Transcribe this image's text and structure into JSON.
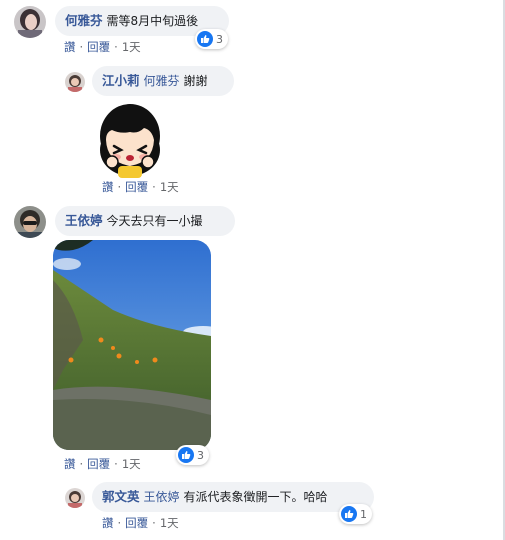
{
  "comments": [
    {
      "author": "何雅芬",
      "text": "需等8月中旬過後",
      "actions": {
        "like": "讚",
        "reply": "回覆",
        "time": "1天"
      },
      "reactions": {
        "icon": "like-icon",
        "count": "3"
      }
    },
    {
      "author": "江小莉",
      "mention": "何雅芬",
      "text": "謝謝",
      "sticker": "cartoon-girl-sticker",
      "actions": {
        "like": "讚",
        "reply": "回覆",
        "time": "1天"
      }
    },
    {
      "author": "王依婷",
      "text": "今天去只有一小撮",
      "photo": "hillside-flowers-photo",
      "actions": {
        "like": "讚",
        "reply": "回覆",
        "time": "1天"
      },
      "reactions": {
        "icon": "like-icon",
        "count": "3"
      }
    },
    {
      "author": "郭文英",
      "mention": "王依婷",
      "text": "有派代表象徵開一下。哈哈",
      "actions": {
        "like": "讚",
        "reply": "回覆",
        "time": "1天"
      },
      "reactions": {
        "icon": "like-icon",
        "count": "1"
      }
    }
  ],
  "colors": {
    "link": "#385898",
    "bubble": "#f0f2f5",
    "like": "#1877f2",
    "meta": "#65676b"
  }
}
